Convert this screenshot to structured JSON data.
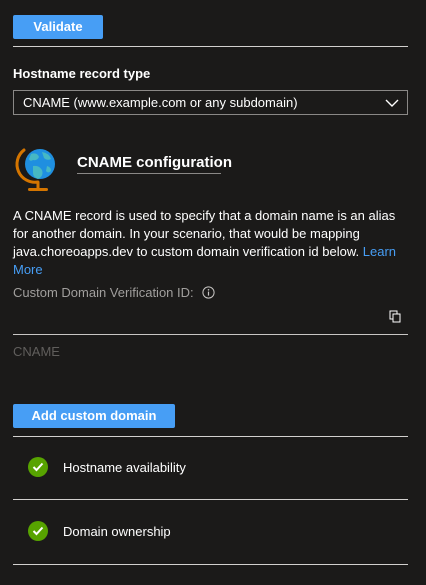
{
  "buttons": {
    "validate": "Validate",
    "add_custom_domain": "Add custom domain"
  },
  "record_type": {
    "label": "Hostname record type",
    "selected": "CNAME (www.example.com or any subdomain)"
  },
  "cname": {
    "heading": "CNAME configuration",
    "description": "A CNAME record is used to specify that a domain name is an alias for another domain. In your scenario, that would be mapping java.choreoapps.dev to custom domain verification id below.",
    "learn_more": "Learn More",
    "verification_label": "Custom Domain Verification ID:",
    "verification_value": "",
    "field_placeholder": "CNAME"
  },
  "checks": [
    {
      "label": "Hostname availability",
      "status": "passed"
    },
    {
      "label": "Domain ownership",
      "status": "passed"
    }
  ],
  "colors": {
    "accent": "#479ef5",
    "success": "#57a300",
    "background": "#1b1a19"
  },
  "icons": {
    "globe": "globe-icon",
    "chevron": "chevron-down-icon",
    "copy": "copy-icon",
    "info": "info-icon",
    "check": "checkmark-circle-icon"
  }
}
